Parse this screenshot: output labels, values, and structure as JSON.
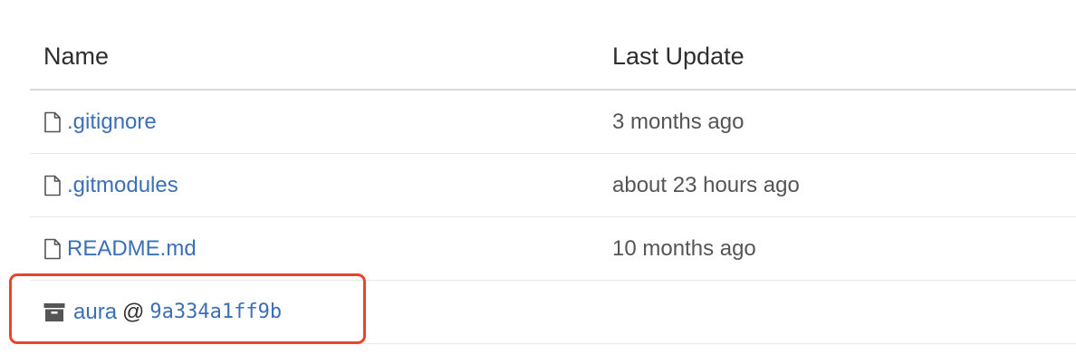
{
  "table": {
    "headers": {
      "name": "Name",
      "last_update": "Last Update"
    },
    "files": [
      {
        "name": ".gitignore",
        "last_update": "3 months ago",
        "icon": "file-icon"
      },
      {
        "name": ".gitmodules",
        "last_update": "about 23 hours ago",
        "icon": "file-icon"
      },
      {
        "name": "README.md",
        "last_update": "10 months ago",
        "icon": "file-icon"
      }
    ],
    "submodule": {
      "name": "aura",
      "separator": "@",
      "commit": "9a334a1ff9b",
      "icon": "archive-box-icon"
    }
  },
  "colors": {
    "link": "#3b6fb6",
    "text": "#2e2e2e",
    "muted": "#555555",
    "highlight": "#e8452c",
    "header_border": "#d9d9d9",
    "row_border": "#e8e8e8"
  }
}
